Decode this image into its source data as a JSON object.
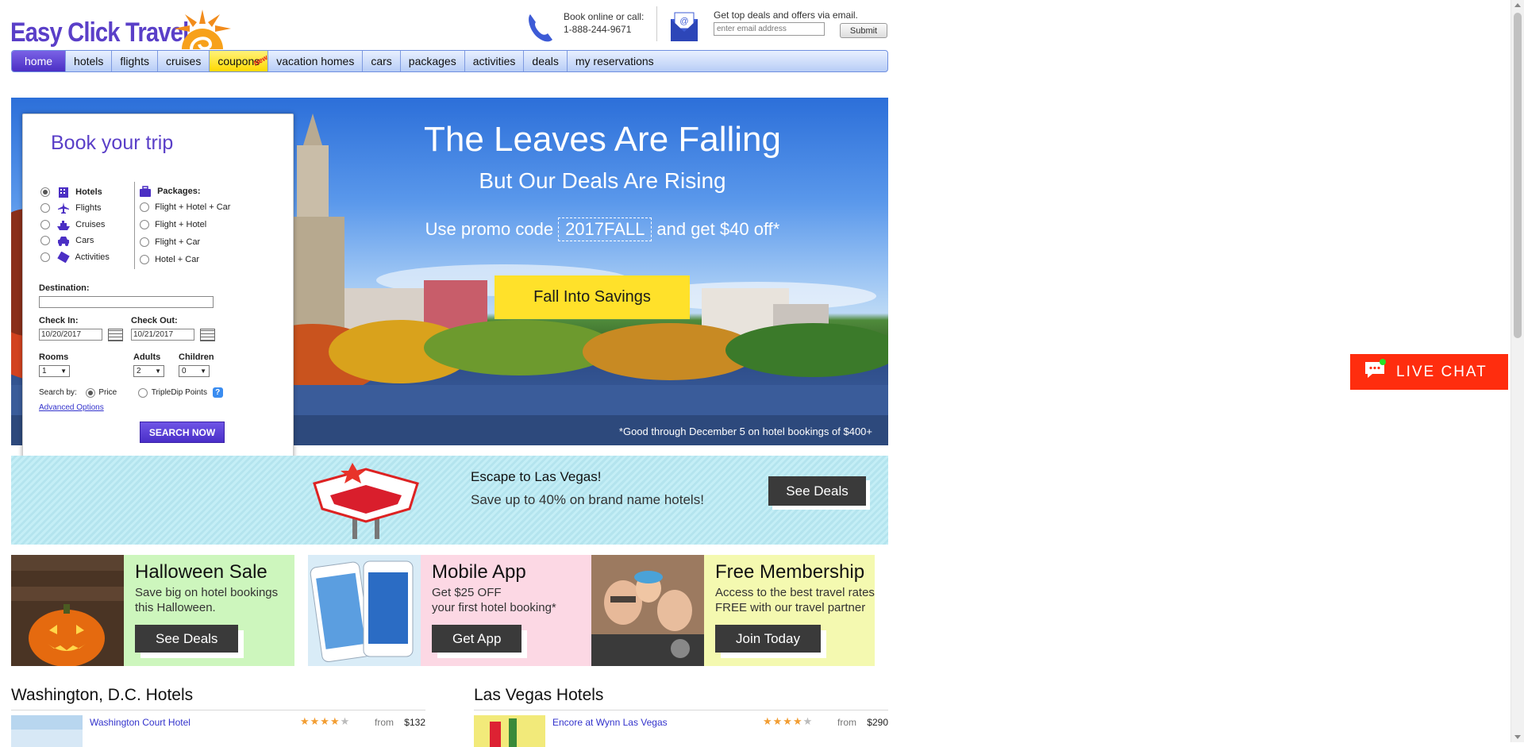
{
  "header": {
    "logo_text": "Easy Click Travel",
    "call_label": "Book online or call:",
    "phone": "1-888-244-9671",
    "deals_label": "Get top deals and offers via email.",
    "email_placeholder": "enter email address",
    "submit_label": "Submit"
  },
  "nav": {
    "items": [
      "home",
      "hotels",
      "flights",
      "cruises",
      "coupons",
      "vacation homes",
      "cars",
      "packages",
      "activities",
      "deals",
      "my reservations"
    ],
    "new_badge": "New",
    "active": "home"
  },
  "hero": {
    "title": "The Leaves Are Falling",
    "subtitle": "But Our Deals Are Rising",
    "promo_prefix": "Use promo code",
    "promo_code": "2017FALL",
    "promo_suffix": "and get $40 off*",
    "cta": "Fall Into Savings",
    "fine_print": "*Good through December 5 on hotel bookings of $400+"
  },
  "booking": {
    "title": "Book your trip",
    "types": [
      "Hotels",
      "Flights",
      "Cruises",
      "Cars",
      "Activities"
    ],
    "selected_type": "Hotels",
    "packages_label": "Packages:",
    "packages": [
      "Flight + Hotel + Car",
      "Flight + Hotel",
      "Flight + Car",
      "Hotel + Car"
    ],
    "destination_label": "Destination:",
    "destination_value": "",
    "checkin_label": "Check In:",
    "checkin_value": "10/20/2017",
    "checkout_label": "Check Out:",
    "checkout_value": "10/21/2017",
    "rooms_label": "Rooms",
    "rooms_value": "1",
    "adults_label": "Adults",
    "adults_value": "2",
    "children_label": "Children",
    "children_value": "0",
    "search_by_label": "Search by:",
    "search_by_price": "Price",
    "search_by_points": "TripleDip Points",
    "help_label": "?",
    "advanced_options": "Advanced Options",
    "search_button": "SEARCH NOW"
  },
  "vegas": {
    "title": "Escape to Las Vegas!",
    "text": "Save up to 40% on brand name hotels!",
    "button": "See Deals"
  },
  "cards": [
    {
      "title": "Halloween Sale",
      "lines": [
        "Save big on hotel bookings",
        "this Halloween."
      ],
      "button": "See Deals"
    },
    {
      "title": "Mobile App",
      "lines": [
        "Get $25 OFF",
        "your first hotel booking*"
      ],
      "button": "Get App"
    },
    {
      "title": "Free Membership",
      "lines": [
        "Access to the best travel rates",
        "FREE with our travel partner"
      ],
      "button": "Join Today"
    }
  ],
  "hotel_lists": [
    {
      "title": "Washington, D.C. Hotels",
      "rows": [
        {
          "name": "Washington Court Hotel",
          "stars": 4,
          "from_label": "from",
          "price": "$132"
        }
      ]
    },
    {
      "title": "Las Vegas Hotels",
      "rows": [
        {
          "name": "Encore at Wynn Las Vegas",
          "stars": 4,
          "from_label": "from",
          "price": "$290"
        }
      ]
    }
  ],
  "chat": {
    "label": "LIVE CHAT"
  },
  "colors": {
    "brand_purple": "#5a3fc8",
    "cta_yellow": "#ffe12a",
    "chat_red": "#ff2d0e",
    "nav_blue": "#b8cdf6"
  }
}
